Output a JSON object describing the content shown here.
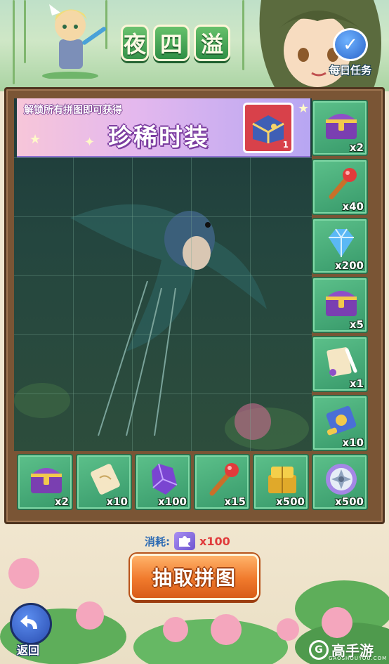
{
  "header": {
    "title_chars": [
      "夜",
      "四",
      "溢"
    ],
    "daily_task_label": "每日任务"
  },
  "banner": {
    "subtitle": "解锁所有拼图即可获得",
    "title": "珍稀时装",
    "reward_count": "1"
  },
  "side_rewards": [
    {
      "icon": "treasure-chest-icon",
      "qty": "x2"
    },
    {
      "icon": "wand-icon",
      "qty": "x40"
    },
    {
      "icon": "diamond-icon",
      "qty": "x200"
    },
    {
      "icon": "treasure-chest-icon",
      "qty": "x5"
    },
    {
      "icon": "scroll-quill-icon",
      "qty": "x1"
    },
    {
      "icon": "blue-scroll-icon",
      "qty": "x10"
    }
  ],
  "bottom_rewards": [
    {
      "icon": "treasure-chest-icon",
      "qty": "x2"
    },
    {
      "icon": "scroll-icon",
      "qty": "x10"
    },
    {
      "icon": "purple-crystal-icon",
      "qty": "x100"
    },
    {
      "icon": "wand-icon",
      "qty": "x15"
    },
    {
      "icon": "gold-bricks-icon",
      "qty": "x500"
    },
    {
      "icon": "sawblade-icon",
      "qty": "x500"
    }
  ],
  "cost": {
    "label": "消耗:",
    "value": "x100"
  },
  "draw_button_label": "抽取拼图",
  "back_label": "返回",
  "watermark": {
    "logo": "G",
    "text": "高手游",
    "sub": "GAOSHOUYOU.COM"
  },
  "colors": {
    "tile_green": "#37996a",
    "frame_wood": "#7a5535",
    "button_orange": "#f07a2c",
    "cost_red": "#e03b3b"
  }
}
